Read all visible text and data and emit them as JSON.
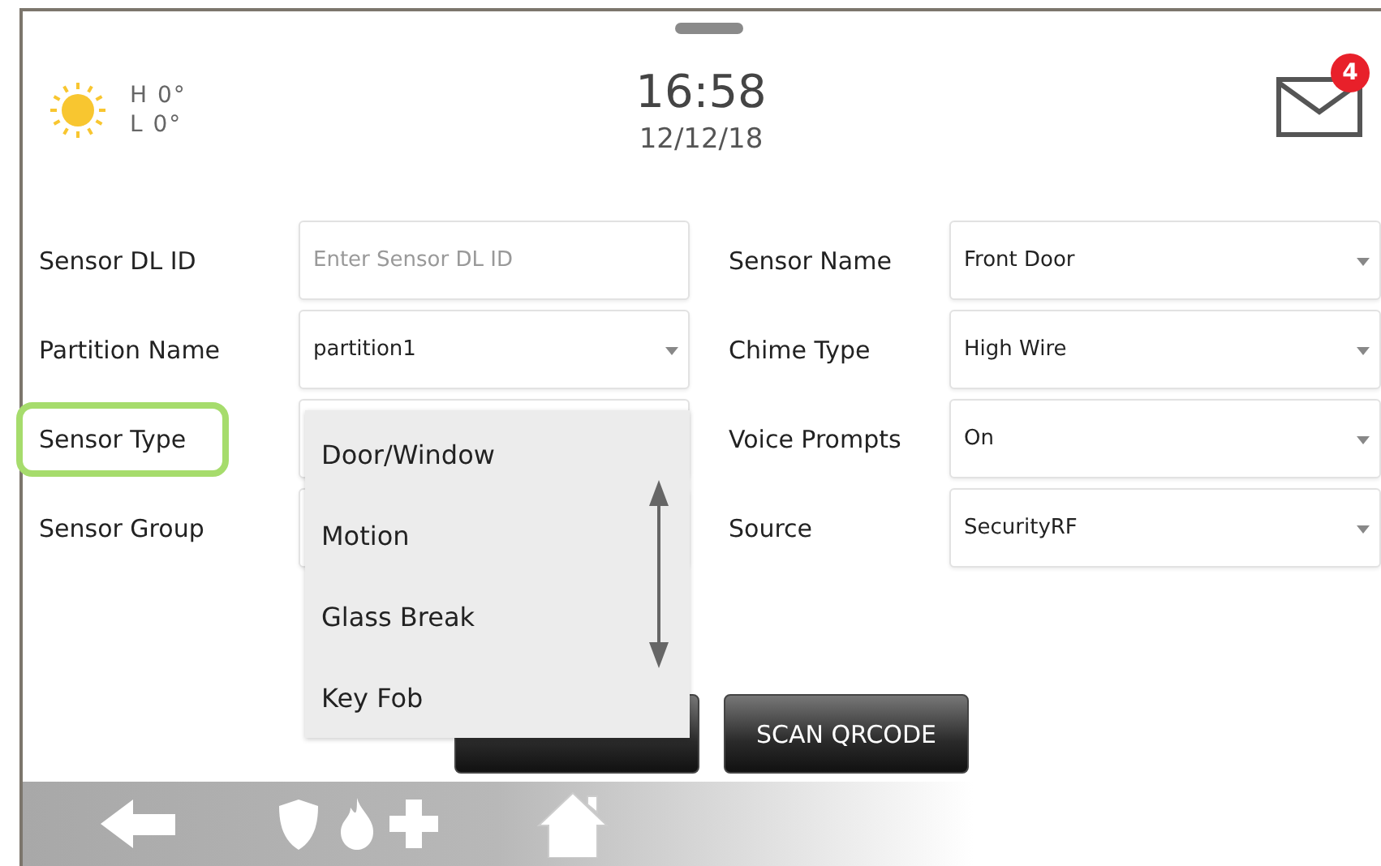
{
  "weather": {
    "high": "H 0°",
    "low": "L 0°"
  },
  "clock": {
    "time": "16:58",
    "date": "12/12/18"
  },
  "messages": {
    "count": "4"
  },
  "form": {
    "left": [
      {
        "label": "Sensor DL ID",
        "kind": "input",
        "placeholder": "Enter Sensor DL ID",
        "highlighted": false
      },
      {
        "label": "Partition Name",
        "kind": "select",
        "value": "partition1",
        "highlighted": false
      },
      {
        "label": "Sensor Type",
        "kind": "select",
        "highlighted": true
      },
      {
        "label": "Sensor Group",
        "kind": "select",
        "highlighted": false
      }
    ],
    "right": [
      {
        "label": "Sensor Name",
        "kind": "select",
        "value": "Front Door",
        "highlighted": false
      },
      {
        "label": "Chime Type",
        "kind": "select",
        "value": "High Wire",
        "highlighted": false
      },
      {
        "label": "Voice Prompts",
        "kind": "select",
        "value": "On",
        "highlighted": false
      },
      {
        "label": "Source",
        "kind": "select",
        "value": "SecurityRF",
        "highlighted": false
      }
    ]
  },
  "dropdown": {
    "options": [
      "Door/Window",
      "Motion",
      "Glass Break",
      "Key Fob"
    ]
  },
  "buttons": [
    {
      "kind": "hidden"
    },
    {
      "kind": "labeled",
      "label": "SCAN QRCODE"
    }
  ]
}
